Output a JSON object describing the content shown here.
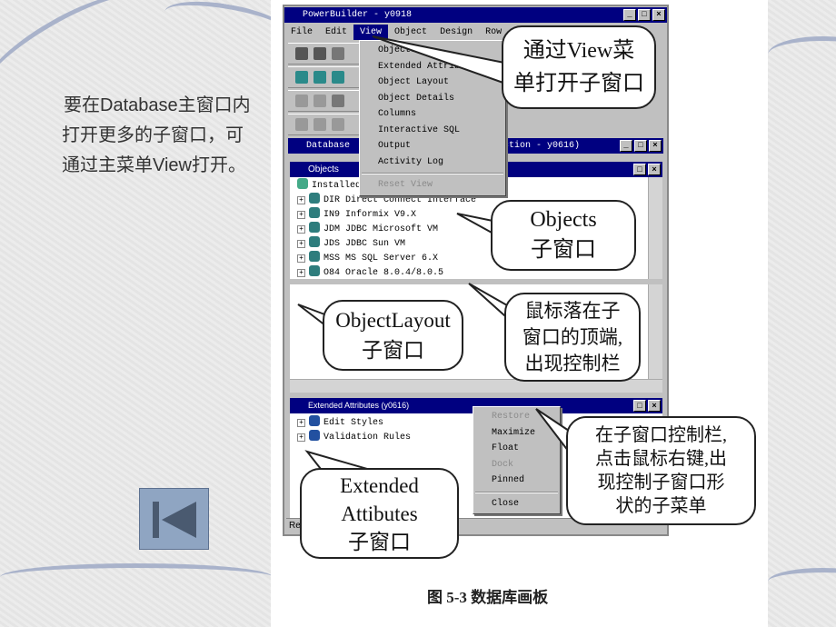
{
  "slide": {
    "text": "要在Database主窗口内打开更多的子窗口，可通过主菜单View打开。",
    "back_button_icon": "skip-back-icon",
    "caption": "图 5-3  数据库画板"
  },
  "window": {
    "title": "PowerBuilder - y0918",
    "menu": [
      "File",
      "Edit",
      "View",
      "Object",
      "Design",
      "Row"
    ],
    "database_title_left": "Database",
    "database_title_right": "nection - y0616)",
    "objects_title": "Objects",
    "objects_rows": [
      "Installed",
      "DIR Direct Connect Interface",
      "IN9 Informix V9.X",
      "JDM JDBC Microsoft VM",
      "JDS JDBC Sun VM",
      "MSS MS SQL Server 6.X",
      "O84 Oracle 8.0.4/8.0.5"
    ],
    "ext_title": "Extended Attributes (y0616)",
    "ext_rows": [
      "Edit Styles",
      "Validation Rules"
    ],
    "status": "Re"
  },
  "view_menu": {
    "items": [
      "Objects",
      "Extended Attributes",
      "Object Layout",
      "Object Details",
      "Columns",
      "Interactive SQL",
      "Output",
      "Activity Log"
    ],
    "disabled_item": "Reset View"
  },
  "context_menu": {
    "items": [
      {
        "label": "Restore",
        "enabled": false
      },
      {
        "label": "Maximize",
        "enabled": true
      },
      {
        "label": "Float",
        "enabled": true
      },
      {
        "label": "Dock",
        "enabled": false
      },
      {
        "label": "Pinned",
        "enabled": true
      }
    ],
    "close": "Close"
  },
  "callouts": {
    "view": [
      "通过View菜",
      "单打开子窗口"
    ],
    "objects": [
      "Objects",
      "子窗口"
    ],
    "layout": [
      "ObjectLayout",
      "子窗口"
    ],
    "mouse": [
      "鼠标落在子",
      "窗口的顶端,",
      "出现控制栏"
    ],
    "rightclick": [
      "在子窗口控制栏,",
      "点击鼠标右键,出",
      "现控制子窗口形",
      "状的子菜单"
    ],
    "extended": [
      "Extended",
      "Attibutes",
      "子窗口"
    ]
  },
  "colors": {
    "titlebar": "#000080",
    "chrome": "#c0c0c0",
    "back_button": "#8fa5c2"
  }
}
